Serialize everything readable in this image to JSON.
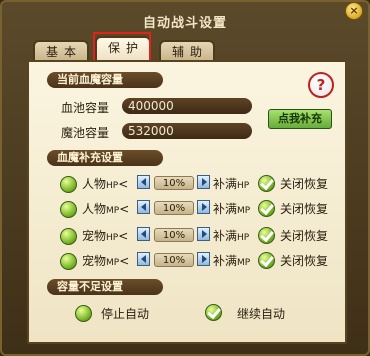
{
  "window": {
    "title": "自动战斗设置",
    "close": "×"
  },
  "tabs": [
    {
      "label": "基本"
    },
    {
      "label": "保护",
      "active": true
    },
    {
      "label": "辅助"
    }
  ],
  "pool": {
    "section_label": "当前血魔容量",
    "hp_label": "血池容量",
    "hp_value": "400000",
    "mp_label": "魔池容量",
    "mp_value": "532000",
    "help_symbol": "?",
    "fill_button": "点我补充"
  },
  "refill": {
    "section_label": "血魔补充设置",
    "rows": [
      {
        "name": "人物",
        "stat": "HP",
        "lt": "<",
        "percent": "10%",
        "fill_text": "补满",
        "fill_stat": "HP",
        "close_text": "关闭恢复"
      },
      {
        "name": "人物",
        "stat": "MP",
        "lt": "<",
        "percent": "10%",
        "fill_text": "补满",
        "fill_stat": "MP",
        "close_text": "关闭恢复"
      },
      {
        "name": "宠物",
        "stat": "HP",
        "lt": "<",
        "percent": "10%",
        "fill_text": "补满",
        "fill_stat": "HP",
        "close_text": "关闭恢复"
      },
      {
        "name": "宠物",
        "stat": "MP",
        "lt": "<",
        "percent": "10%",
        "fill_text": "补满",
        "fill_stat": "MP",
        "close_text": "关闭恢复"
      }
    ]
  },
  "insufficient": {
    "section_label": "容量不足设置",
    "stop_label": "停止自动",
    "continue_label": "继续自动"
  }
}
